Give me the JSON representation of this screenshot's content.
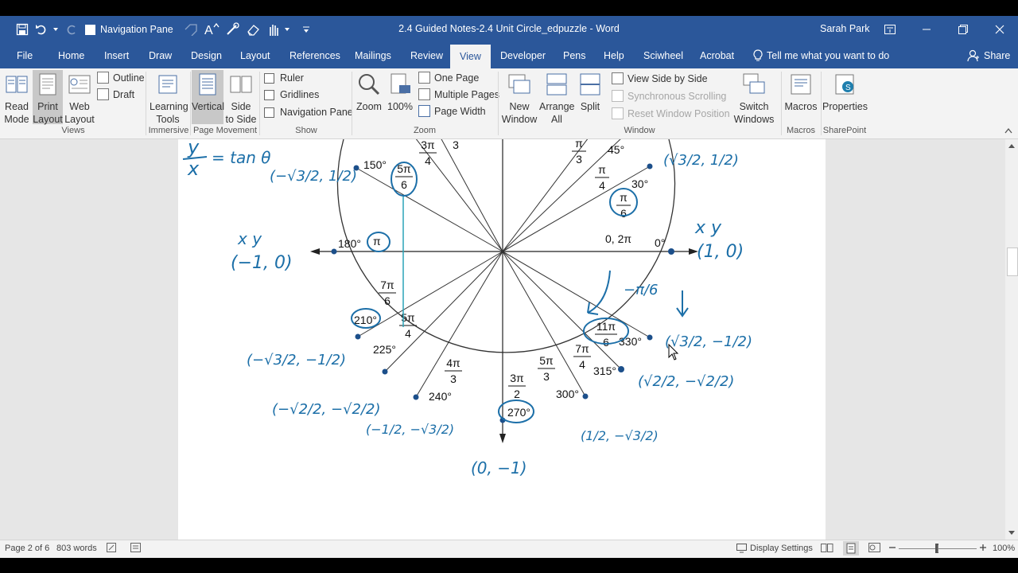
{
  "titlebar": {
    "qat_label": "Navigation Pane",
    "doc_title": "2.4 Guided Notes-2.4 Unit Circle_edpuzzle  -  Word",
    "user": "Sarah Park"
  },
  "tabs": [
    "File",
    "Home",
    "Insert",
    "Draw",
    "Design",
    "Layout",
    "References",
    "Mailings",
    "Review",
    "View",
    "Developer",
    "Pens",
    "Help",
    "Sciwheel",
    "Acrobat"
  ],
  "active_tab": "View",
  "tell_me": "Tell me what you want to do",
  "share": "Share",
  "ribbon": {
    "views": {
      "label": "Views",
      "read_mode": [
        "Read",
        "Mode"
      ],
      "print_layout": [
        "Print",
        "Layout"
      ],
      "web_layout": [
        "Web",
        "Layout"
      ],
      "outline": "Outline",
      "draft": "Draft"
    },
    "immersive": {
      "label": "Immersive",
      "learning_tools": [
        "Learning",
        "Tools"
      ]
    },
    "page_movement": {
      "label": "Page Movement",
      "vertical": "Vertical",
      "side_to_side": [
        "Side",
        "to Side"
      ]
    },
    "show": {
      "label": "Show",
      "ruler": "Ruler",
      "gridlines": "Gridlines",
      "navigation_pane": "Navigation Pane"
    },
    "zoom": {
      "label": "Zoom",
      "zoom": "Zoom",
      "hundred": "100%",
      "one_page": "One Page",
      "multiple_pages": "Multiple Pages",
      "page_width": "Page Width"
    },
    "window": {
      "label": "Window",
      "new_window": [
        "New",
        "Window"
      ],
      "arrange_all": [
        "Arrange",
        "All"
      ],
      "split": "Split",
      "view_side": "View Side by Side",
      "sync_scroll": "Synchronous Scrolling",
      "reset_pos": "Reset Window Position",
      "switch_windows": [
        "Switch",
        "Windows"
      ]
    },
    "macros": {
      "label": "Macros",
      "macros": "Macros"
    },
    "sharepoint": {
      "label": "SharePoint",
      "properties": "Properties"
    }
  },
  "diagram": {
    "printed_labels": {
      "deg_150": "150°",
      "deg_45": "45°",
      "deg_30": "30°",
      "deg_180": "180°",
      "zero_2pi": "0, 2π",
      "deg_0": "0°",
      "deg_210": "210°",
      "deg_225": "225°",
      "deg_240": "240°",
      "deg_270": "270°",
      "deg_300": "300°",
      "deg_315": "315°",
      "deg_330": "330°",
      "pi": "π"
    },
    "fractions": [
      {
        "id": "3pi-4",
        "num": "3π",
        "den": "4"
      },
      {
        "id": "2pi-3",
        "num": "π",
        "den": "3"
      },
      {
        "id": "pi-3",
        "num": "π",
        "den": "3"
      },
      {
        "id": "pi-4",
        "num": "π",
        "den": "4"
      },
      {
        "id": "pi-6",
        "num": "π",
        "den": "6"
      },
      {
        "id": "5pi-6",
        "num": "5π",
        "den": "6"
      },
      {
        "id": "7pi-6",
        "num": "7π",
        "den": "6"
      },
      {
        "id": "5pi-4",
        "num": "5π",
        "den": "4"
      },
      {
        "id": "4pi-3",
        "num": "4π",
        "den": "3"
      },
      {
        "id": "3pi-2",
        "num": "3π",
        "den": "2"
      },
      {
        "id": "5pi-3",
        "num": "5π",
        "den": "3"
      },
      {
        "id": "7pi-4",
        "num": "7π",
        "den": "4"
      },
      {
        "id": "11pi-6",
        "num": "11π",
        "den": "6"
      }
    ],
    "handwritten": {
      "tan_y": "y",
      "tan_x": "x",
      "tan_eq": "= tan θ",
      "xy_left": "x   y",
      "pt_neg1_0": "(−1, 0)",
      "xy_right": "x   y",
      "pt_1_0": "(1, 0)",
      "pt_0_neg1": "(0, −1)",
      "neg_pi_6": "−π/6",
      "pt_150": "(−√3/2, 1/2)",
      "pt_30": "(√3/2, 1/2)",
      "pt_210": "(−√3/2, −1/2)",
      "pt_330": "(√3/2, −1/2)",
      "pt_225": "(−√2/2, −√2/2)",
      "pt_315": "(√2/2, −√2/2)",
      "pt_240": "(−1/2, −√3/2)",
      "pt_300": "(1/2, −√3/2)"
    }
  },
  "status": {
    "page": "Page 2 of 6",
    "words": "803 words",
    "display_settings": "Display Settings",
    "zoom": "100%"
  },
  "colors": {
    "brand": "#2b579a",
    "ink": "#1c6fa8",
    "teal": "#2aa3b8"
  }
}
